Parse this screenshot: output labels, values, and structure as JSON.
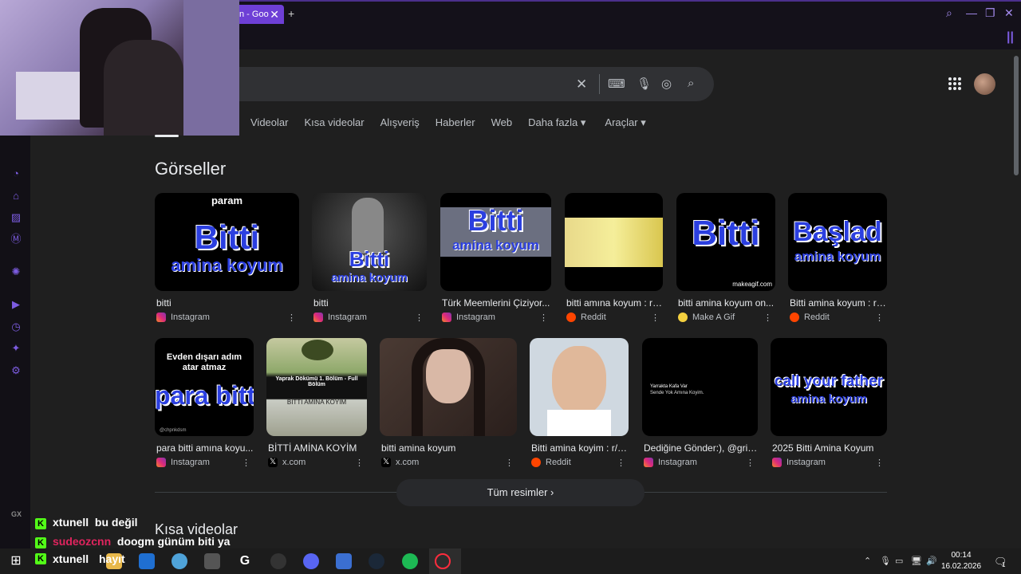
{
  "browser": {
    "tab_title": "n - Goo",
    "tab_close": "✕",
    "new_tab": "+"
  },
  "search": {
    "clear": "✕"
  },
  "nav_tabs": [
    "Videolar",
    "Kısa videolar",
    "Alışveriş",
    "Haberler",
    "Web",
    "Daha fazla ▾",
    "Araçlar ▾"
  ],
  "images_section": {
    "title": "Görseller",
    "row1": [
      {
        "title": "bitti",
        "source": "Instagram",
        "source_icon": "instagram-icon",
        "thumb": {
          "top": "param",
          "big": "Bitti",
          "bottom": "amina koyum"
        }
      },
      {
        "title": "bitti",
        "source": "Instagram",
        "source_icon": "instagram-icon",
        "thumb": {
          "big": "Bitti",
          "bottom": "amina koyum"
        }
      },
      {
        "title": "Türk Meemlerini Çiziyor...",
        "source": "Instagram",
        "source_icon": "instagram-icon",
        "thumb": {
          "big": "Bitti",
          "bottom": "amina koyum"
        }
      },
      {
        "title": "bitti amına koyum : r/i...",
        "source": "Reddit",
        "source_icon": "reddit-icon",
        "thumb": {}
      },
      {
        "title": "bitti amina koyum on...",
        "source": "Make A Gif",
        "source_icon": "makeagif-icon",
        "thumb": {
          "big": "Bitti",
          "bottom": "makeagif.com"
        }
      },
      {
        "title": "Bitti amina koyum : r/...",
        "source": "Reddit",
        "source_icon": "reddit-icon",
        "thumb": {
          "big": "Başlad",
          "bottom": "amina koyum"
        }
      }
    ],
    "row2": [
      {
        "title": "para bitti amına koyu...",
        "source": "Instagram",
        "source_icon": "instagram-icon",
        "thumb": {
          "top": "Evden dışarı adım atar atmaz",
          "big": "para bitti",
          "bottom": "@chpnkdsm"
        }
      },
      {
        "title": "BİTTİ AMİNA KOYİM",
        "source": "x.com",
        "source_icon": "x-icon",
        "thumb": {
          "top": "Yaprak Dökümü 1. Bölüm - Full Bölüm",
          "bottom": "BİTTİ AMİNA KOYİM"
        }
      },
      {
        "title": "bitti amina koyum",
        "source": "x.com",
        "source_icon": "x-icon",
        "thumb": {}
      },
      {
        "title": "Bitti amina koyim : r/v...",
        "source": "Reddit",
        "source_icon": "reddit-icon",
        "thumb": {}
      },
      {
        "title": "Dediğine Gönder:), @grit...",
        "source": "Instagram",
        "source_icon": "instagram-icon",
        "thumb": {
          "top": "Yarrakta Kafa Var",
          "line2": "Sende Yok Amına Koyim."
        }
      },
      {
        "title": "2025 Bitti Amina Koyum",
        "source": "Instagram",
        "source_icon": "instagram-icon",
        "thumb": {
          "big": "call your father",
          "bottom": "amina koyum"
        }
      }
    ],
    "more_button": "Tüm resimler  ›"
  },
  "short_videos": {
    "title": "Kısa videolar"
  },
  "chat": [
    {
      "user": "xtunell",
      "user_color": "#ffffff",
      "message": "bu değil"
    },
    {
      "user": "sudeozcnn",
      "user_color": "#e0245e",
      "message": "doogm günüm biti ya"
    },
    {
      "user": "xtunell",
      "user_color": "#ffffff",
      "message": "hayıt"
    }
  ],
  "sidebar_label": "GX",
  "taskbar": {
    "time": "00:14",
    "date": "16.02.2026",
    "notifications": "1"
  },
  "colors": {
    "accent": "#6e3fd6",
    "background": "#1f1f1f",
    "kick_green": "#53fc18"
  }
}
